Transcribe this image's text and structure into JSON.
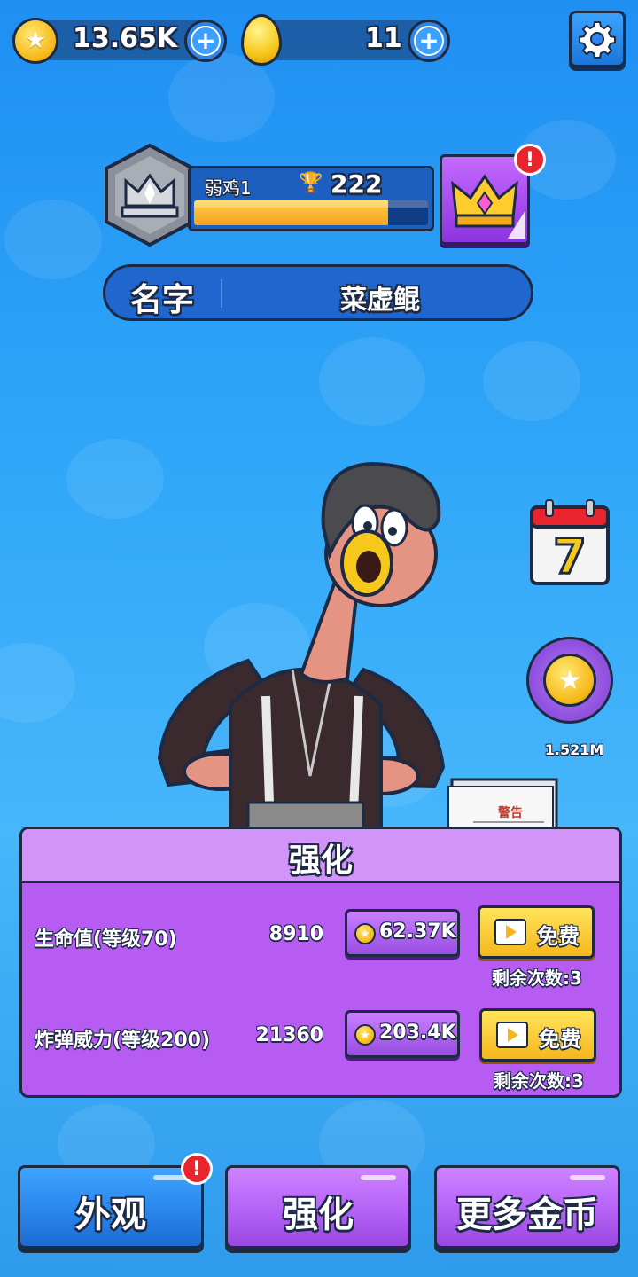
{
  "currency": {
    "coins": "13.65K",
    "eggs": "11"
  },
  "rank": {
    "name": "弱鸡1",
    "trophies": "222",
    "progress": 0.83
  },
  "name_bar": {
    "label": "名字",
    "value": "菜虚鲲"
  },
  "daily": {
    "calendar_day": "7",
    "coin_reward": "1.521M"
  },
  "paper_label": "警告",
  "upgrade_panel": {
    "title": "强化",
    "rows": [
      {
        "label": "生命值(等级70)",
        "value": "8910",
        "cost": "62.37K",
        "free_label": "免费",
        "remaining": "剩余次数:3"
      },
      {
        "label": "炸弹威力(等级200)",
        "value": "21360",
        "cost": "203.4K",
        "free_label": "免费",
        "remaining": "剩余次数:3"
      }
    ]
  },
  "bottom_nav": {
    "appearance": "外观",
    "upgrade": "强化",
    "more_coins": "更多金币"
  },
  "colors": {
    "background": "#2fa6f8",
    "panel": "#b65cf2",
    "gold": "#f5b715",
    "alert": "#e8242d"
  }
}
